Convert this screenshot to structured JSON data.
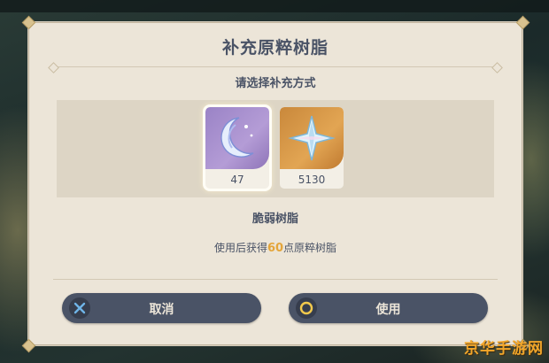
{
  "dialog": {
    "title": "补充原粹树脂",
    "subtitle": "请选择补充方式",
    "items": [
      {
        "icon": "crescent-moon-resin-icon",
        "count": "47",
        "selected": true
      },
      {
        "icon": "primogem-star-icon",
        "count": "5130",
        "selected": false
      }
    ],
    "selected_item_name": "脆弱树脂",
    "description": {
      "prefix": "使用后获得",
      "amount": "60",
      "suffix": "点原粹树脂"
    },
    "buttons": {
      "cancel_label": "取消",
      "cancel_icon": "x-button-icon",
      "use_label": "使用",
      "use_icon": "circle-button-icon"
    }
  },
  "watermark": "京华手游网",
  "colors": {
    "panel": "#ece5d8",
    "text": "#4a5366",
    "button": "#4a5366",
    "highlight": "#e4a53a",
    "purple_rarity": "#9a83c6",
    "gold_rarity": "#d89a48"
  }
}
